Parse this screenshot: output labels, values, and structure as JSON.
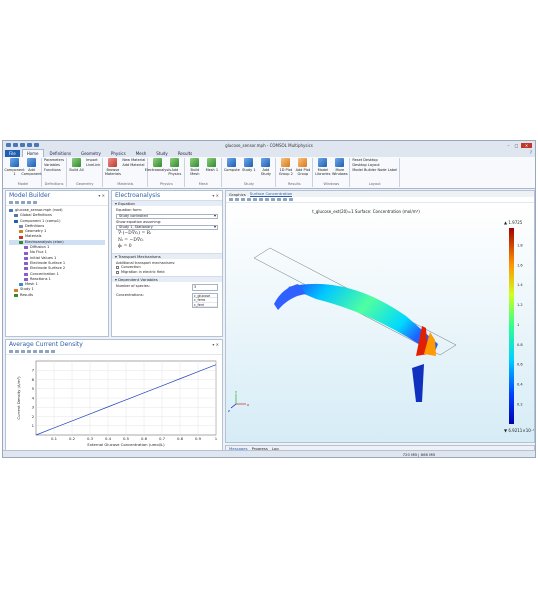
{
  "window": {
    "title": "glucose_sensor.mph - COMSOL Multiphysics"
  },
  "ribbon_tabs": [
    "File",
    "Home",
    "Definitions",
    "Geometry",
    "Physics",
    "Mesh",
    "Study",
    "Results"
  ],
  "active_tab": "Home",
  "ribbon": {
    "groups": [
      {
        "label": "Model",
        "buttons": [
          "Component 1",
          "Add Component"
        ]
      },
      {
        "label": "Definitions",
        "small": [
          "Parameters",
          "Variables",
          "Functions"
        ]
      },
      {
        "label": "Geometry",
        "buttons": [
          "Build All"
        ],
        "small": [
          "Import",
          "LiveLink"
        ]
      },
      {
        "label": "Materials",
        "buttons": [
          "Browse Materials"
        ],
        "small": [
          "New Material",
          "Add Material"
        ]
      },
      {
        "label": "Physics",
        "buttons": [
          "Electroanalysis",
          "Add Physics"
        ]
      },
      {
        "label": "Mesh",
        "buttons": [
          "Build Mesh",
          "Mesh 1"
        ]
      },
      {
        "label": "Study",
        "buttons": [
          "Compute",
          "Study 1",
          "Add Study"
        ]
      },
      {
        "label": "Results",
        "buttons": [
          "1D Plot Group 2",
          "Add Plot Group"
        ]
      },
      {
        "label": "Windows",
        "buttons": [
          "Model Libraries",
          "More Windows"
        ]
      },
      {
        "label": "Layout",
        "small": [
          "Reset Desktop",
          "Desktop Layout",
          "Model Builder Node Label"
        ]
      }
    ]
  },
  "model_builder": {
    "title": "Model Builder",
    "tree": [
      {
        "label": "glucose_sensor.mph (root)",
        "level": 0,
        "color": "#4a77b5"
      },
      {
        "label": "Global Definitions",
        "level": 1,
        "color": "#4a77b5"
      },
      {
        "label": "Component 1 (comp1)",
        "level": 1,
        "color": "#1f5fb1"
      },
      {
        "label": "Definitions",
        "level": 2,
        "color": "#7a8ea8"
      },
      {
        "label": "Geometry 1",
        "level": 2,
        "color": "#d97a1c"
      },
      {
        "label": "Materials",
        "level": 2,
        "color": "#c0392b"
      },
      {
        "label": "Electroanalysis (elan)",
        "level": 2,
        "color": "#2f8a2f",
        "selected": true
      },
      {
        "label": "Diffusion 1",
        "level": 3,
        "color": "#8a5cc9"
      },
      {
        "label": "No Flux 1",
        "level": 3,
        "color": "#8a5cc9"
      },
      {
        "label": "Initial Values 1",
        "level": 3,
        "color": "#8a5cc9"
      },
      {
        "label": "Electrode Surface 1",
        "level": 3,
        "color": "#8a5cc9"
      },
      {
        "label": "Electrode Surface 2",
        "level": 3,
        "color": "#8a5cc9"
      },
      {
        "label": "Concentration 1",
        "level": 3,
        "color": "#8a5cc9"
      },
      {
        "label": "Reactions 1",
        "level": 3,
        "color": "#8a5cc9"
      },
      {
        "label": "Mesh 1",
        "level": 2,
        "color": "#3a8ad0"
      },
      {
        "label": "Study 1",
        "level": 1,
        "color": "#d97a1c"
      },
      {
        "label": "Results",
        "level": 1,
        "color": "#2f8a2f"
      }
    ]
  },
  "settings": {
    "title": "Electroanalysis",
    "equation_section": "Equation",
    "equation_form_label": "Equation form:",
    "equation_form_value": "Study controlled",
    "show_eq_label": "Show equation assuming:",
    "show_eq_value": "Study 1, Stationary",
    "eq1": "∇·(−D∇cᵢ) = Rᵢ",
    "eq2": "Nᵢ = −D∇cᵢ",
    "eq3": "ϕₗ = 0",
    "transport_section": "Transport Mechanisms",
    "transport_label": "Additional transport mechanisms:",
    "convection": "Convection",
    "migration": "Migration in electric field",
    "dependent_section": "Dependent Variables",
    "num_species_label": "Number of species:",
    "num_species_value": "3",
    "concentrations_label": "Concentrations:",
    "species": [
      "c_glucose",
      "c_ferro",
      "c_ferri"
    ]
  },
  "graphics": {
    "tabs": [
      "Graphics",
      "Surface Concentration"
    ],
    "plot_title": "t_glucose_ext(20)=1   Surface: Concentration (mol/m³)",
    "colorbar_max": "▲ 1.9725",
    "colorbar_min": "▼ 6.9211×10⁻⁶",
    "colorbar_ticks": [
      "1.8",
      "1.6",
      "1.4",
      "1.2",
      "1",
      "0.8",
      "0.6",
      "0.4",
      "0.2"
    ],
    "axis_labels": [
      "x",
      "y",
      "z"
    ]
  },
  "avg_plot": {
    "title": "Average Current Density",
    "chart_data": {
      "type": "line",
      "xlabel": "External Glucose Concentration (umol/L)",
      "ylabel": "Current Density (A/m²)",
      "x": [
        0,
        0.1,
        0.2,
        0.3,
        0.4,
        0.5,
        0.6,
        0.7,
        0.8,
        0.9,
        1.0
      ],
      "series": [
        {
          "values": [
            0,
            0.76,
            1.52,
            2.28,
            3.04,
            3.8,
            4.56,
            5.32,
            6.08,
            6.84,
            7.6
          ]
        }
      ],
      "xticks": [
        "0.1",
        "0.2",
        "0.3",
        "0.4",
        "0.5",
        "0.6",
        "0.7",
        "0.8",
        "0.9",
        "1"
      ],
      "yticks": [
        "1",
        "2",
        "3",
        "4",
        "5",
        "6",
        "7"
      ],
      "xlim": [
        0,
        1
      ],
      "ylim": [
        0,
        8
      ],
      "color": "#1f3fbf"
    }
  },
  "messages_tabs": [
    "Messages",
    "Progress",
    "Log"
  ],
  "status_memory": "720 MB | 866 MB"
}
